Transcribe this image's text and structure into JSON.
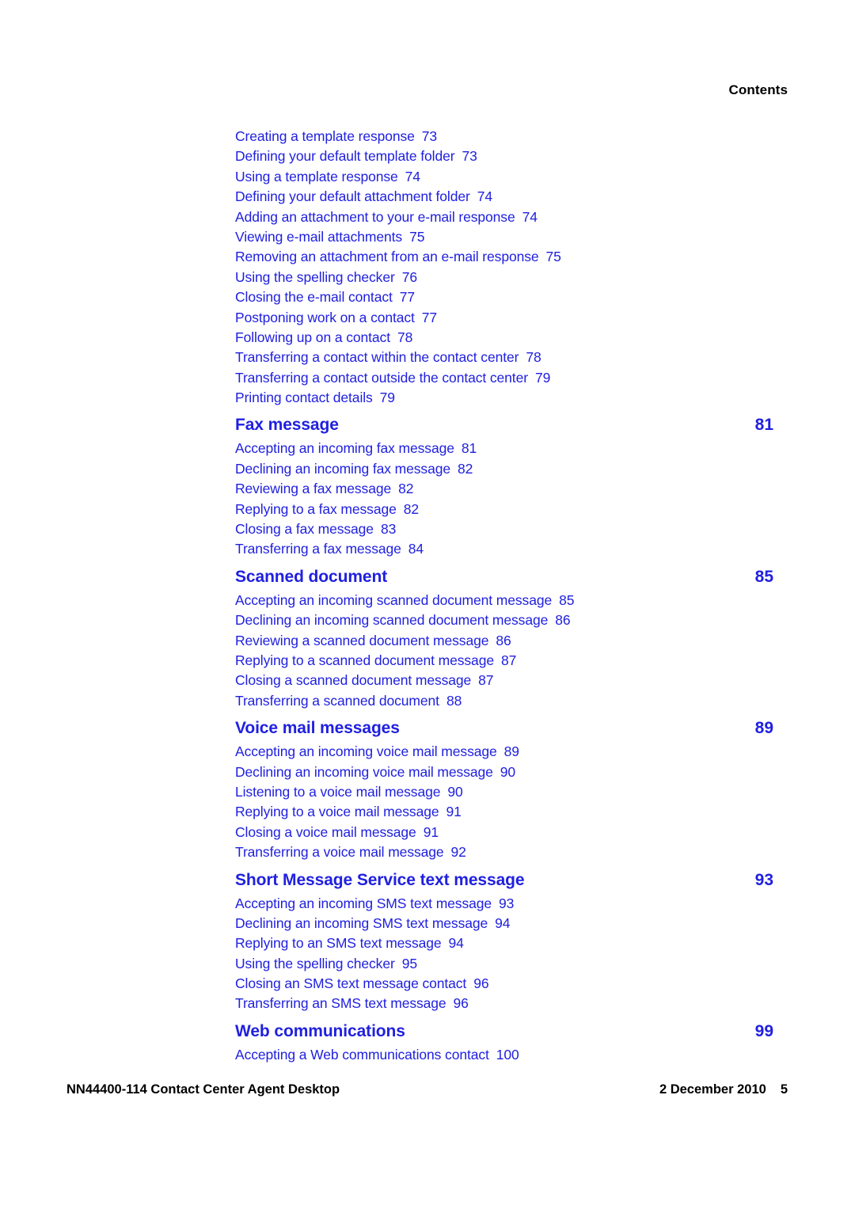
{
  "colors": {
    "link_blue": "#2020e0",
    "text_black": "#000000",
    "page_background": "#ffffff"
  },
  "header": {
    "running_head": "Contents"
  },
  "toc": {
    "rows": [
      {
        "kind": "entry",
        "title": "Creating a template response",
        "page": "73"
      },
      {
        "kind": "entry",
        "title": "Defining your default template folder",
        "page": "73"
      },
      {
        "kind": "entry",
        "title": "Using a template response",
        "page": "74"
      },
      {
        "kind": "entry",
        "title": "Defining your default attachment folder",
        "page": "74"
      },
      {
        "kind": "entry",
        "title": "Adding an attachment to your e-mail response",
        "page": "74"
      },
      {
        "kind": "entry",
        "title": "Viewing e-mail attachments",
        "page": "75"
      },
      {
        "kind": "entry",
        "title": "Removing an attachment from an e-mail response",
        "page": "75"
      },
      {
        "kind": "entry",
        "title": "Using the spelling checker",
        "page": "76"
      },
      {
        "kind": "entry",
        "title": "Closing the e-mail contact",
        "page": "77"
      },
      {
        "kind": "entry",
        "title": "Postponing work on a contact",
        "page": "77"
      },
      {
        "kind": "entry",
        "title": "Following up on a contact",
        "page": "78"
      },
      {
        "kind": "entry",
        "title": "Transferring a contact within the contact center",
        "page": "78"
      },
      {
        "kind": "entry",
        "title": "Transferring a contact outside the contact center",
        "page": "79"
      },
      {
        "kind": "entry",
        "title": "Printing contact details",
        "page": "79"
      },
      {
        "kind": "section",
        "title": "Fax message",
        "page": "81"
      },
      {
        "kind": "entry",
        "title": "Accepting an incoming fax message",
        "page": "81"
      },
      {
        "kind": "entry",
        "title": "Declining an incoming fax message",
        "page": "82"
      },
      {
        "kind": "entry",
        "title": "Reviewing a fax message",
        "page": "82"
      },
      {
        "kind": "entry",
        "title": "Replying to a fax message",
        "page": "82"
      },
      {
        "kind": "entry",
        "title": "Closing a fax message",
        "page": "83"
      },
      {
        "kind": "entry",
        "title": "Transferring a fax message",
        "page": "84"
      },
      {
        "kind": "section",
        "title": "Scanned document",
        "page": "85"
      },
      {
        "kind": "entry",
        "title": "Accepting an incoming scanned document message",
        "page": "85"
      },
      {
        "kind": "entry",
        "title": "Declining an incoming scanned document message",
        "page": "86"
      },
      {
        "kind": "entry",
        "title": "Reviewing a scanned document message",
        "page": "86"
      },
      {
        "kind": "entry",
        "title": "Replying to a scanned document message",
        "page": "87"
      },
      {
        "kind": "entry",
        "title": "Closing a scanned document message",
        "page": "87"
      },
      {
        "kind": "entry",
        "title": "Transferring a scanned document",
        "page": "88"
      },
      {
        "kind": "section",
        "title": "Voice mail messages",
        "page": "89"
      },
      {
        "kind": "entry",
        "title": "Accepting an incoming voice mail message",
        "page": "89"
      },
      {
        "kind": "entry",
        "title": "Declining an incoming voice mail message",
        "page": "90"
      },
      {
        "kind": "entry",
        "title": "Listening to a voice mail message",
        "page": "90"
      },
      {
        "kind": "entry",
        "title": "Replying to a voice mail message",
        "page": "91"
      },
      {
        "kind": "entry",
        "title": "Closing a voice mail message",
        "page": "91"
      },
      {
        "kind": "entry",
        "title": "Transferring a voice mail message",
        "page": "92"
      },
      {
        "kind": "section",
        "title": "Short Message Service text message",
        "page": "93"
      },
      {
        "kind": "entry",
        "title": "Accepting an incoming SMS text message",
        "page": "93"
      },
      {
        "kind": "entry",
        "title": "Declining an incoming SMS text message",
        "page": "94"
      },
      {
        "kind": "entry",
        "title": "Replying to an SMS text message",
        "page": "94"
      },
      {
        "kind": "entry",
        "title": "Using the spelling checker",
        "page": "95"
      },
      {
        "kind": "entry",
        "title": "Closing an SMS text message contact",
        "page": "96"
      },
      {
        "kind": "entry",
        "title": "Transferring an SMS text message",
        "page": "96"
      },
      {
        "kind": "section",
        "title": "Web communications",
        "page": "99"
      },
      {
        "kind": "entry",
        "title": "Accepting a Web communications contact",
        "page": "100"
      }
    ]
  },
  "footer": {
    "document_id_and_title": "NN44400-114 Contact Center Agent Desktop",
    "date": "2 December 2010",
    "page_number": "5"
  }
}
